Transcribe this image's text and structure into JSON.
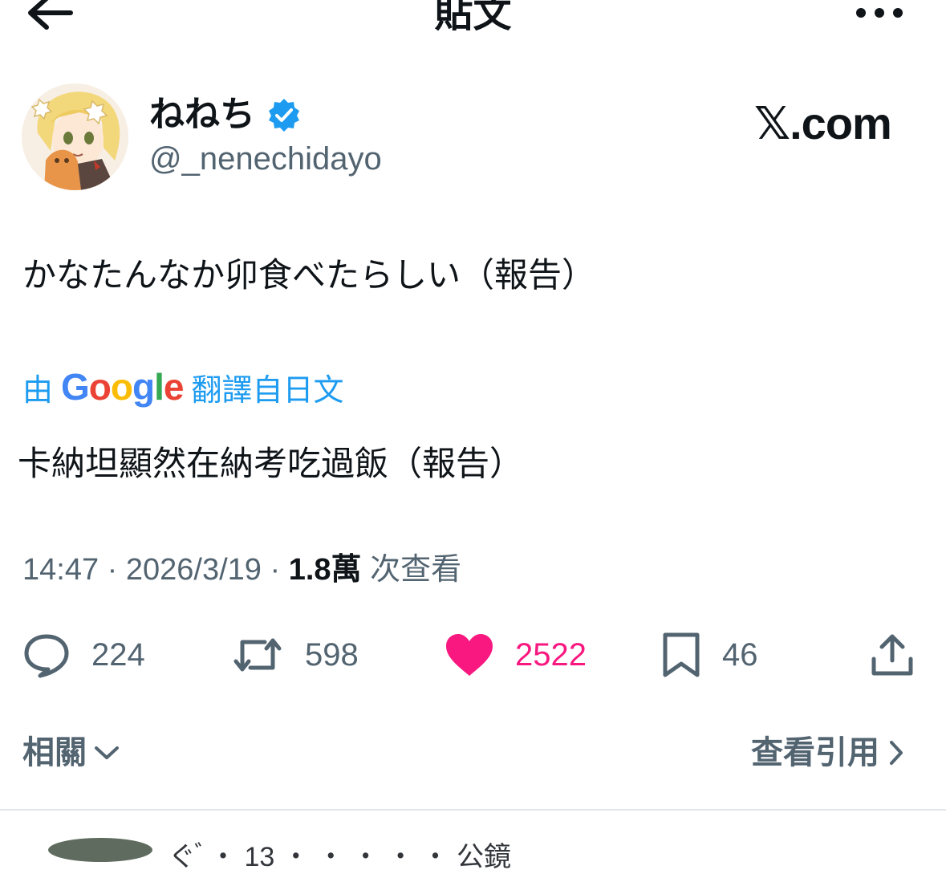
{
  "header": {
    "title": "貼文"
  },
  "author": {
    "display_name": "ねねち",
    "handle": "@_nenechidayo",
    "verified": true,
    "avatar_icon": "anime-girl-avatar"
  },
  "brand": {
    "text": "𝕏.com"
  },
  "post": {
    "text": "かなたんなか卯食べたらしい（報告）",
    "translate_prefix": "由",
    "translate_google": "Google",
    "translate_suffix": "翻譯自日文",
    "translated_text": "卡納坦顯然在納考吃過飯（報告）",
    "time": "14:47",
    "date": "2026/3/19",
    "views_count": "1.8萬",
    "views_label": "次查看"
  },
  "actions": {
    "replies": "224",
    "reposts": "598",
    "likes": "2522",
    "bookmarks": "46"
  },
  "footer": {
    "related_label": "相關",
    "quotes_label": "查看引用"
  },
  "next_post_peek": "ぐ ゙ ・ 13 ・ ・ ・ ・ ・ 公鏡",
  "colors": {
    "accent": "#1d9bf0",
    "like": "#f91880",
    "muted": "#536471",
    "text": "#0f1419"
  }
}
